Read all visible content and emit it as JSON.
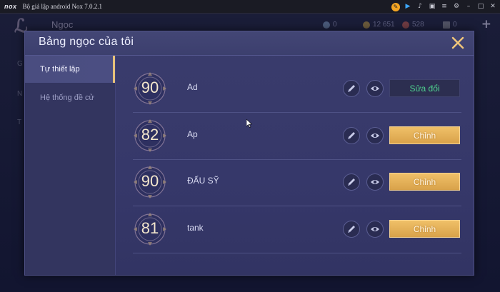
{
  "window": {
    "logo": "nox",
    "title": "Bộ giả lập android Nox 7.0.2.1",
    "icons": [
      "pin-icon",
      "play-icon",
      "mic-icon",
      "screen-icon",
      "menu-icon",
      "settings-icon",
      "minimize-icon",
      "maximize-icon",
      "close-icon"
    ]
  },
  "background": {
    "title": "Ngọc",
    "currencies": [
      {
        "icon": "gem-icon",
        "value": "0"
      },
      {
        "icon": "gold-icon",
        "value": "12 651"
      },
      {
        "icon": "ruby-icon",
        "value": "528"
      },
      {
        "icon": "card-icon",
        "value": "0"
      }
    ],
    "side_items": [
      "G",
      "N",
      "T"
    ]
  },
  "dialog": {
    "title": "Bảng ngọc của tôi",
    "tabs": [
      {
        "label": "Tự thiết lập",
        "active": true
      },
      {
        "label": "Hệ thống đề cử",
        "active": false
      }
    ],
    "rows": [
      {
        "score": "90",
        "name": "Ad",
        "action": "Sửa đổi",
        "action_style": "dark"
      },
      {
        "score": "82",
        "name": "Ap",
        "action": "Chỉnh",
        "action_style": "gold"
      },
      {
        "score": "90",
        "name": "ĐẤU SỸ",
        "action": "Chỉnh",
        "action_style": "gold"
      },
      {
        "score": "81",
        "name": "tank",
        "action": "Chỉnh",
        "action_style": "gold"
      }
    ]
  },
  "colors": {
    "accent_gold": "#e7c27a",
    "active_green": "#4fd28f",
    "dialog_bg": "#3a3c6c"
  }
}
